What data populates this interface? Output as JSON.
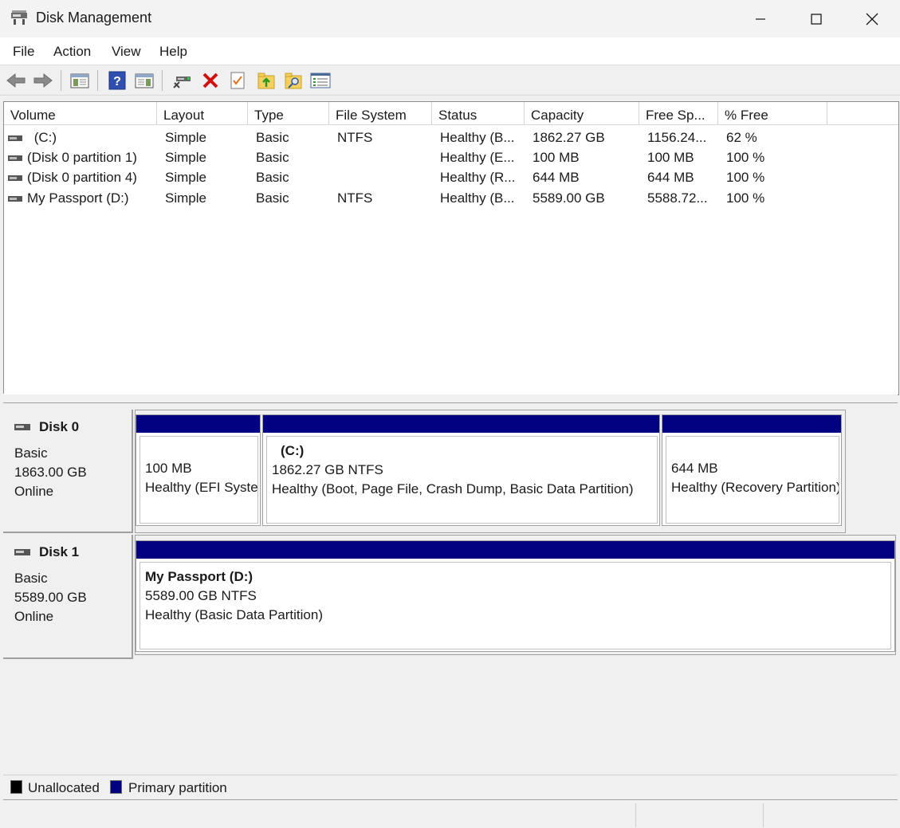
{
  "window": {
    "title": "Disk Management"
  },
  "menu": [
    "File",
    "Action",
    "View",
    "Help"
  ],
  "toolbar_icons": [
    "back-arrow-icon",
    "forward-arrow-icon",
    "show-hide-console-tree-icon",
    "help-icon",
    "show-hide-action-pane-icon",
    "connect-drive-icon",
    "delete-icon",
    "properties-icon",
    "up-folder-icon",
    "search-folder-icon",
    "list-view-icon"
  ],
  "columns": [
    "Volume",
    "Layout",
    "Type",
    "File System",
    "Status",
    "Capacity",
    "Free Sp...",
    "% Free"
  ],
  "volumes": [
    {
      "volume": "(C:)",
      "layout": "Simple",
      "type": "Basic",
      "fs": "NTFS",
      "status": "Healthy (B...",
      "capacity": "1862.27 GB",
      "free": "1156.24...",
      "pct": "62 %"
    },
    {
      "volume": "(Disk 0 partition 1)",
      "layout": "Simple",
      "type": "Basic",
      "fs": "",
      "status": "Healthy (E...",
      "capacity": "100 MB",
      "free": "100 MB",
      "pct": "100 %"
    },
    {
      "volume": "(Disk 0 partition 4)",
      "layout": "Simple",
      "type": "Basic",
      "fs": "",
      "status": "Healthy (R...",
      "capacity": "644 MB",
      "free": "644 MB",
      "pct": "100 %"
    },
    {
      "volume": "My Passport (D:)",
      "layout": "Simple",
      "type": "Basic",
      "fs": "NTFS",
      "status": "Healthy (B...",
      "capacity": "5589.00 GB",
      "free": "5588.72...",
      "pct": "100 %"
    }
  ],
  "disks": [
    {
      "name": "Disk 0",
      "type": "Basic",
      "size": "1863.00 GB",
      "state": "Online",
      "partitions": [
        {
          "title": "",
          "line1": "100 MB",
          "line2": "Healthy (EFI System Partition)"
        },
        {
          "title": "(C:)",
          "line1": "1862.27 GB NTFS",
          "line2": "Healthy (Boot, Page File, Crash Dump, Basic Data Partition)"
        },
        {
          "title": "",
          "line1": "644 MB",
          "line2": "Healthy (Recovery Partition)"
        }
      ]
    },
    {
      "name": "Disk 1",
      "type": "Basic",
      "size": "5589.00 GB",
      "state": "Online",
      "partitions": [
        {
          "title": "My Passport  (D:)",
          "line1": "5589.00 GB NTFS",
          "line2": "Healthy (Basic Data Partition)"
        }
      ]
    }
  ],
  "legend": [
    {
      "label": "Unallocated",
      "color": "#000000"
    },
    {
      "label": "Primary partition",
      "color": "#000080"
    }
  ],
  "colors": {
    "primary_partition": "#000080",
    "unallocated": "#000000"
  }
}
